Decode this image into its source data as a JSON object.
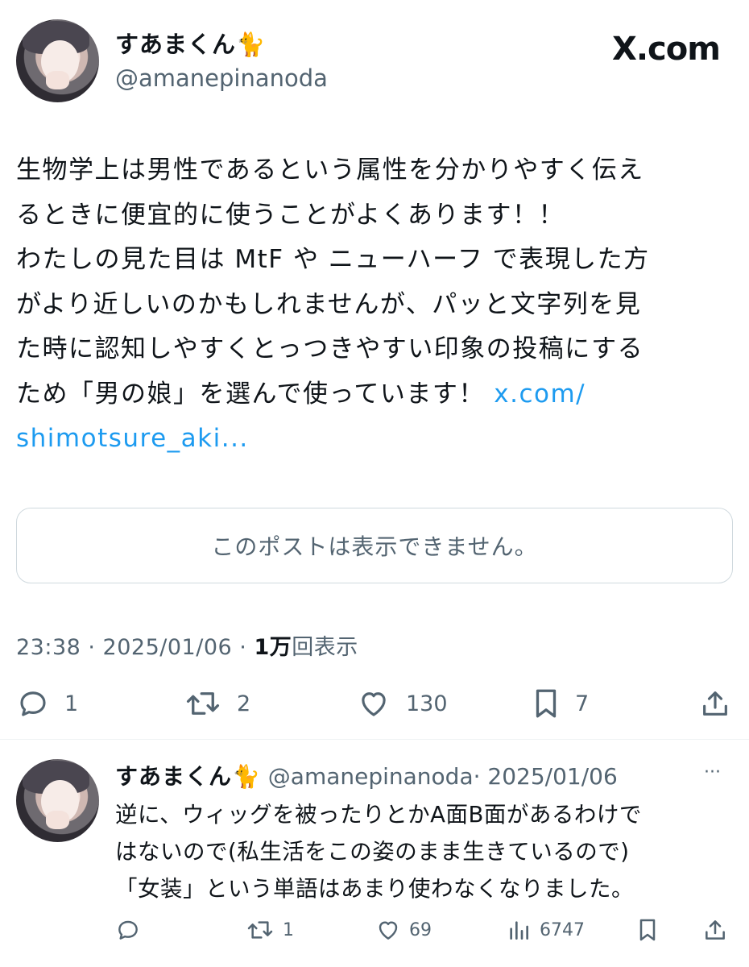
{
  "post": {
    "author_name": "すあまくん🐈",
    "author_handle": "@amanepinanoda",
    "site_logo": "X.com",
    "lines": [
      "生物学上は男性であるという属性を分かりやすく伝え",
      "るときに便宜的に使うことがよくあります！！",
      "わたしの見た目は MtF や ニューハーフ で表現した方",
      "がより近しいのかもしれませんが、パッと文字列を見",
      "た時に認知しやすくとっつきやすい印象の投稿にする",
      "ため「男の娘」を選んで使っています！ "
    ],
    "link_part1": "x.com/",
    "link_part2": "shimotsure_aki...",
    "quote_unavailable": "このポストは表示できません。",
    "time": "23:38 · 2025/01/06 · ",
    "views_count": "1万",
    "views_label": "回表示",
    "actions": {
      "replies": "1",
      "reposts": "2",
      "likes": "130",
      "bookmarks": "7"
    }
  },
  "reply": {
    "author_name": "すあまくん🐈",
    "author_handle": "@amanepinanoda",
    "date": "· 2025/01/06",
    "more": "···",
    "lines": [
      "逆に、ウィッグを被ったりとかA面B面があるわけで",
      "はないので(私生活をこの姿のまま生きているので)",
      "「女装」という単語はあまり使わなくなりました。"
    ],
    "actions": {
      "replies": "",
      "reposts": "1",
      "likes": "69",
      "views": "6747"
    }
  },
  "colors": {
    "link": "#1d9bf0",
    "secondary_text": "#536471",
    "primary_text": "#0f1419",
    "border": "#cfd9de"
  }
}
